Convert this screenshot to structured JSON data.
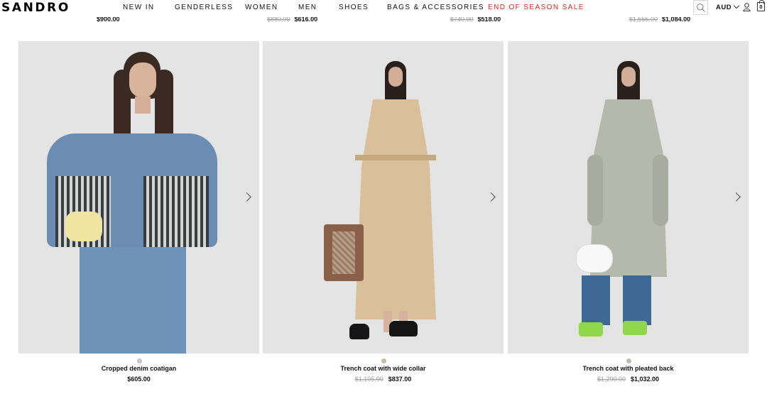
{
  "header": {
    "logo": "SANDRO",
    "nav": [
      {
        "label": "NEW IN",
        "sale": false
      },
      {
        "label": "GENDERLESS",
        "sale": false
      },
      {
        "label": "WOMEN",
        "sale": false
      },
      {
        "label": "MEN",
        "sale": false
      },
      {
        "label": "SHOES",
        "sale": false
      },
      {
        "label": "BAGS & ACCESSORIES",
        "sale": false
      },
      {
        "label": "END OF SEASON SALE",
        "sale": true
      }
    ],
    "currency": "AUD",
    "cart_count": "0",
    "icons": [
      "search-icon",
      "chevron-down-icon",
      "user-icon",
      "bag-icon"
    ]
  },
  "previous_row": [
    {
      "old_price": "",
      "price": "$900.00"
    },
    {
      "old_price": "$880.00",
      "price": "$616.00"
    },
    {
      "old_price": "$740.00",
      "price": "$518.00"
    },
    {
      "old_price": "$1,555.00",
      "price": "$1,084.00"
    }
  ],
  "products": [
    {
      "name": "Cropped denim coatigan",
      "old_price": "",
      "price": "$605.00",
      "swatch_color": "#c9c9c9"
    },
    {
      "name": "Trench coat with wide collar",
      "old_price": "$1,195.00",
      "price": "$837.00",
      "swatch_color": "#d9b98d"
    },
    {
      "name": "Trench coat with pleated back",
      "old_price": "$1,290.00",
      "price": "$1,032.00",
      "swatch_color": "#b8bcae"
    }
  ],
  "colors": {
    "sale": "#e2261c",
    "photo_bg": "#e4e4e4"
  }
}
